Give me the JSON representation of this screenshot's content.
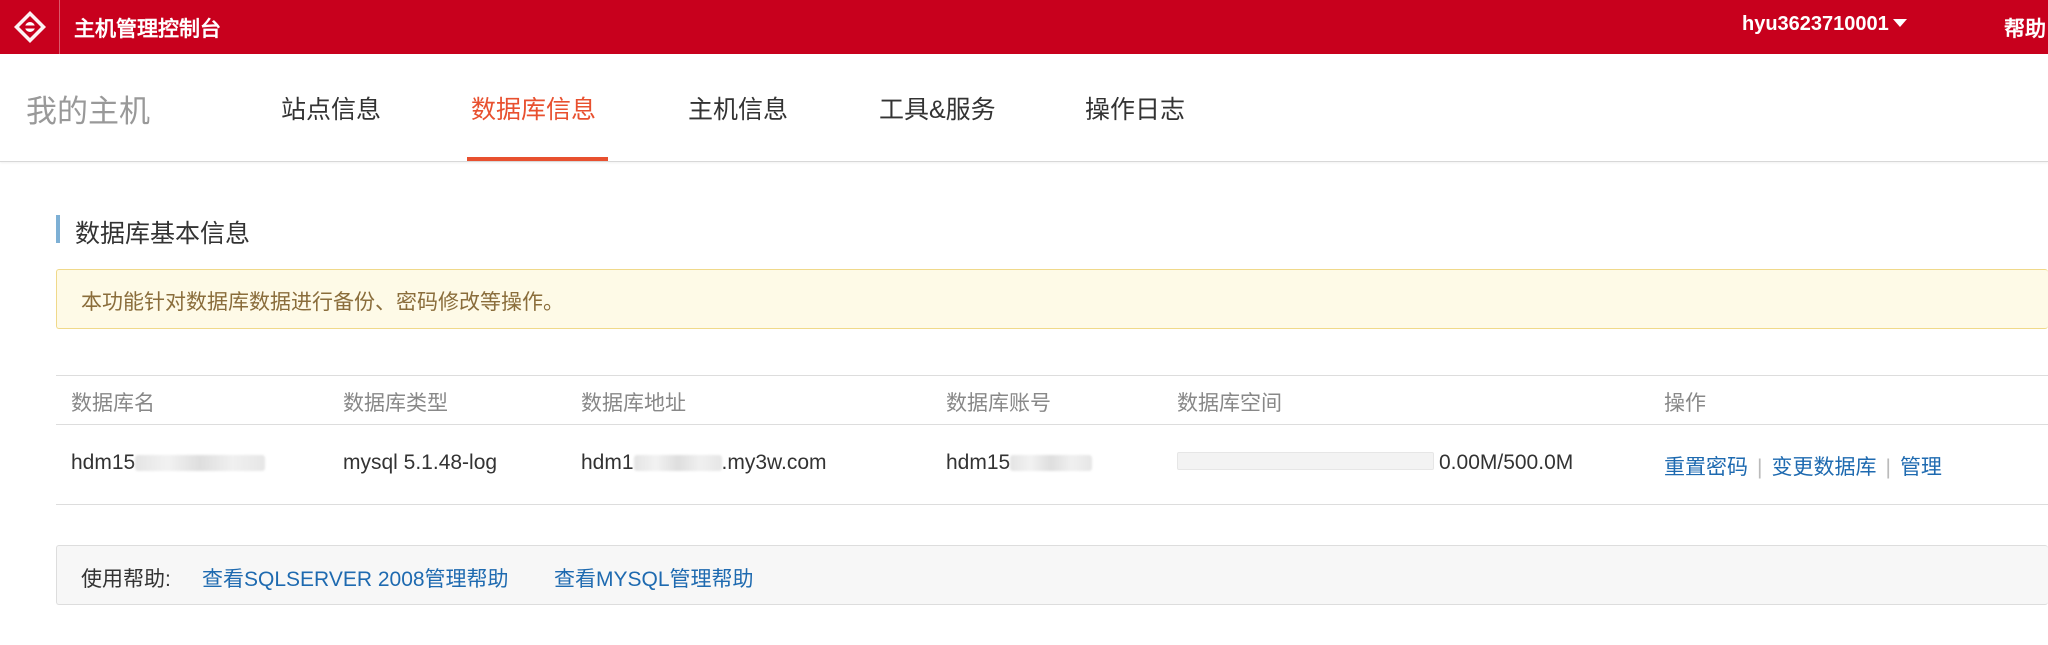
{
  "header": {
    "title": "主机管理控制台",
    "username": "hyu3623710001",
    "help_label": "帮助",
    "brand_color": "#c8001d"
  },
  "nav": {
    "my_host": "我的主机",
    "tabs": [
      {
        "label": "站点信息",
        "active": false
      },
      {
        "label": "数据库信息",
        "active": true
      },
      {
        "label": "主机信息",
        "active": false
      },
      {
        "label": "工具&服务",
        "active": false
      },
      {
        "label": "操作日志",
        "active": false
      }
    ],
    "active_color": "#e8502f"
  },
  "section": {
    "title": "数据库基本信息"
  },
  "notice": {
    "text": "本功能针对数据库数据进行备份、密码修改等操作。"
  },
  "table": {
    "columns": [
      "数据库名",
      "数据库类型",
      "数据库地址",
      "数据库账号",
      "数据库空间",
      "操作"
    ],
    "rows": [
      {
        "name_prefix": "hdm15",
        "type": "mysql 5.1.48-log",
        "address_prefix": "hdm1",
        "address_suffix": ".my3w.com",
        "account_prefix": "hdm15",
        "space_used_fraction": 0.0,
        "space_text": "0.00M/500.0M",
        "actions": [
          "重置密码",
          "变更数据库",
          "管理"
        ],
        "action_separator": "|"
      }
    ]
  },
  "help": {
    "label": "使用帮助:",
    "links": [
      "查看SQLSERVER 2008管理帮助",
      "查看MYSQL管理帮助"
    ]
  }
}
